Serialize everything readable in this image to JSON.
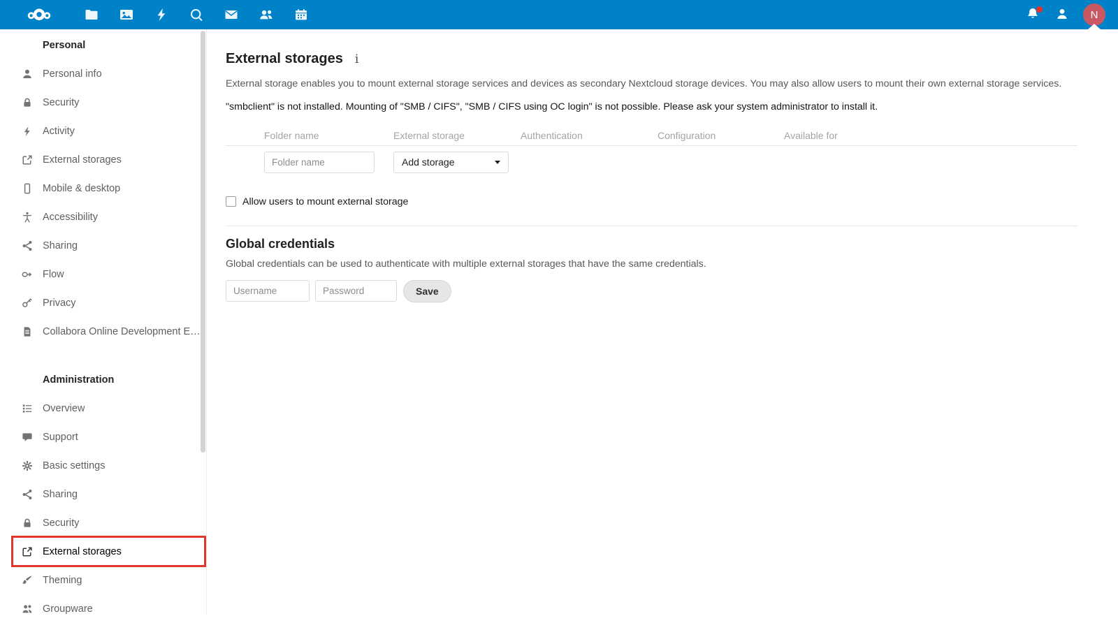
{
  "topbar": {
    "background_color": "#0082c9",
    "logo": {
      "icon": "nextcloud-logo"
    },
    "apps": [
      {
        "icon": "files-icon"
      },
      {
        "icon": "photos-icon"
      },
      {
        "icon": "activity-icon"
      },
      {
        "icon": "search-icon"
      },
      {
        "icon": "mail-icon"
      },
      {
        "icon": "contacts-icon"
      },
      {
        "icon": "calendar-icon"
      }
    ],
    "right": {
      "bell": {
        "icon": "bell-icon",
        "unread_dot_color": "#e9322d"
      },
      "contacts_menu": {
        "icon": "contacts-menu-icon"
      },
      "avatar": {
        "initial": "N",
        "color": "#c95862"
      }
    }
  },
  "sidebar": {
    "highlight_color": "#e0362c",
    "sections": [
      {
        "label": "Personal",
        "items": [
          {
            "icon": "user-icon",
            "label": "Personal info"
          },
          {
            "icon": "lock-icon",
            "label": "Security"
          },
          {
            "icon": "flash-icon",
            "label": "Activity"
          },
          {
            "icon": "external-link-icon",
            "label": "External storages"
          },
          {
            "icon": "mobile-icon",
            "label": "Mobile & desktop"
          },
          {
            "icon": "accessibility-icon",
            "label": "Accessibility"
          },
          {
            "icon": "share-icon",
            "label": "Sharing"
          },
          {
            "icon": "flow-icon",
            "label": "Flow"
          },
          {
            "icon": "key-icon",
            "label": "Privacy"
          },
          {
            "icon": "document-icon",
            "label": "Collabora Online Development Edit..."
          }
        ]
      },
      {
        "label": "Administration",
        "items": [
          {
            "icon": "list-icon",
            "label": "Overview"
          },
          {
            "icon": "comment-icon",
            "label": "Support"
          },
          {
            "icon": "gear-icon",
            "label": "Basic settings"
          },
          {
            "icon": "share-icon",
            "label": "Sharing"
          },
          {
            "icon": "lock-icon",
            "label": "Security"
          },
          {
            "icon": "external-link-icon",
            "label": "External storages",
            "active": true
          },
          {
            "icon": "brush-icon",
            "label": "Theming"
          },
          {
            "icon": "group-icon",
            "label": "Groupware"
          }
        ]
      }
    ]
  },
  "main": {
    "title": "External storages",
    "info_glyph": "i",
    "intro": "External storage enables you to mount external storage services and devices as secondary Nextcloud storage devices. You may also allow users to mount their own external storage services.",
    "warning": "\"smbclient\" is not installed. Mounting of \"SMB / CIFS\", \"SMB / CIFS using OC login\" is not possible. Please ask your system administrator to install it.",
    "table": {
      "headers": [
        "",
        "Folder name",
        "External storage",
        "Authentication",
        "Configuration",
        "Available for"
      ],
      "new_row": {
        "folder_placeholder": "Folder name",
        "storage_select_label": "Add storage"
      }
    },
    "allow_users_label": "Allow users to mount external storage",
    "global_credentials": {
      "title": "Global credentials",
      "description": "Global credentials can be used to authenticate with multiple external storages that have the same credentials.",
      "username_placeholder": "Username",
      "password_placeholder": "Password",
      "save_label": "Save"
    }
  }
}
